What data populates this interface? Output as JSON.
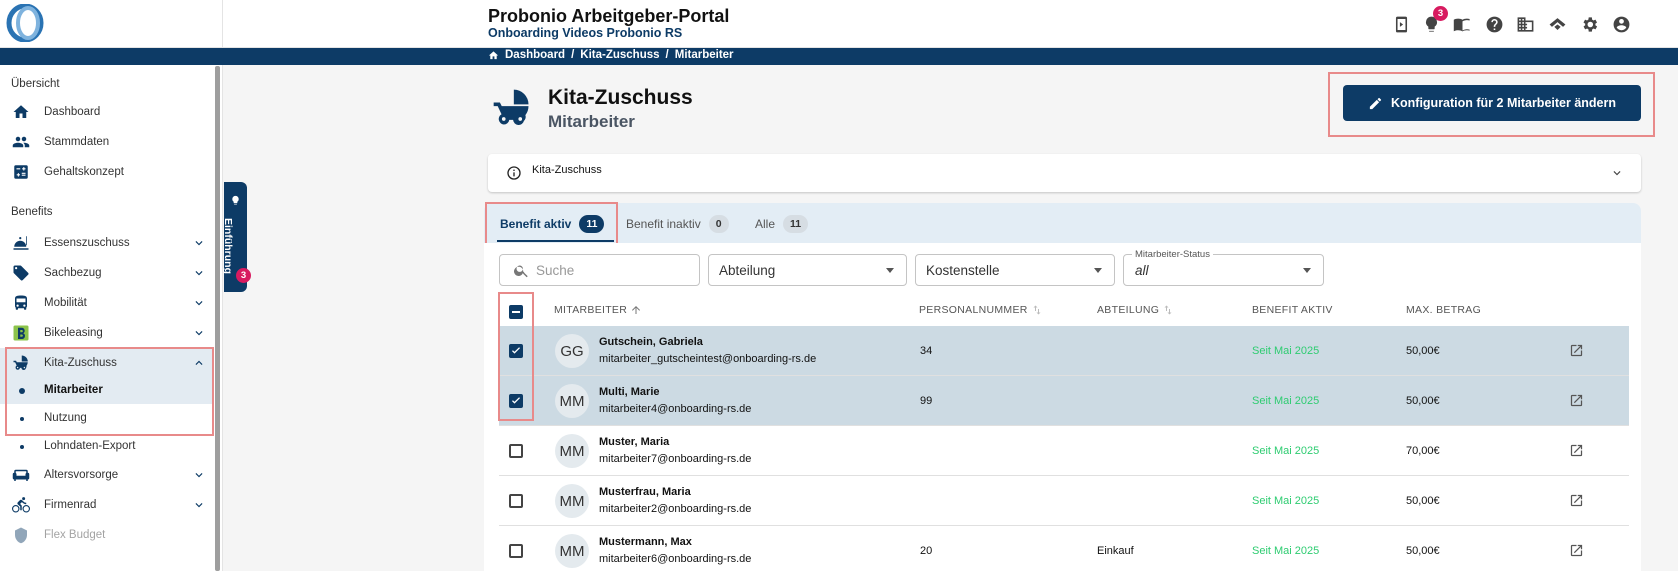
{
  "header": {
    "title": "Probonio Arbeitgeber-Portal",
    "subtitle": "Onboarding Videos Probonio RS",
    "notification_count": "3",
    "icons": [
      "phone-icon",
      "lightbulb-icon",
      "book-icon",
      "help-icon",
      "building-icon",
      "handshake-icon",
      "settings-icon",
      "account-icon"
    ]
  },
  "breadcrumb": {
    "items": [
      "Dashboard",
      "Kita-Zuschuss",
      "Mitarbeiter"
    ],
    "separator": "/"
  },
  "sidebar": {
    "section_overview": "Übersicht",
    "overview_items": [
      {
        "label": "Dashboard",
        "icon": "home-icon"
      },
      {
        "label": "Stammdaten",
        "icon": "people-icon"
      },
      {
        "label": "Gehaltskonzept",
        "icon": "calculator-icon"
      }
    ],
    "section_benefits": "Benefits",
    "benefit_items": [
      {
        "label": "Essenszuschuss",
        "icon": "food-icon"
      },
      {
        "label": "Sachbezug",
        "icon": "tag-icon"
      },
      {
        "label": "Mobilität",
        "icon": "bus-icon"
      },
      {
        "label": "Bikeleasing",
        "icon": "bikeleasing-icon"
      },
      {
        "label": "Kita-Zuschuss",
        "icon": "stroller-icon",
        "expanded": true
      }
    ],
    "kita_sub_items": [
      {
        "label": "Mitarbeiter",
        "active": true
      },
      {
        "label": "Nutzung"
      },
      {
        "label": "Lohndaten-Export"
      }
    ],
    "more_items": [
      {
        "label": "Altersvorsorge",
        "icon": "couch-icon"
      },
      {
        "label": "Firmenrad",
        "icon": "bike-icon"
      },
      {
        "label": "Flex Budget",
        "icon": "flex-icon"
      }
    ]
  },
  "tour": {
    "label": "Einführung",
    "count": "3"
  },
  "page": {
    "title": "Kita-Zuschuss",
    "subtitle": "Mitarbeiter",
    "config_button": "Konfiguration für 2 Mitarbeiter ändern",
    "info_text": "Kita-Zuschuss"
  },
  "tabs": [
    {
      "label": "Benefit aktiv",
      "count": "11",
      "active": true
    },
    {
      "label": "Benefit inaktiv",
      "count": "0"
    },
    {
      "label": "Alle",
      "count": "11"
    }
  ],
  "filters": {
    "search_placeholder": "Suche",
    "department": "Abteilung",
    "cost_center": "Kostenstelle",
    "status_label": "Mitarbeiter-Status",
    "status_value": "all"
  },
  "table": {
    "columns": [
      "MITARBEITER",
      "PERSONALNUMMER",
      "ABTEILUNG",
      "BENEFIT AKTIV",
      "MAX. BETRAG"
    ],
    "rows": [
      {
        "initials": "GG",
        "name": "Gutschein, Gabriela",
        "email": "mitarbeiter_gutscheintest@onboarding-rs.de",
        "personal_number": "34",
        "department": "",
        "benefit_active": "Seit Mai 2025",
        "max_amount": "50,00€",
        "selected": true
      },
      {
        "initials": "MM",
        "name": "Multi, Marie",
        "email": "mitarbeiter4@onboarding-rs.de",
        "personal_number": "99",
        "department": "",
        "benefit_active": "Seit Mai 2025",
        "max_amount": "50,00€",
        "selected": true
      },
      {
        "initials": "MM",
        "name": "Muster, Maria",
        "email": "mitarbeiter7@onboarding-rs.de",
        "personal_number": "",
        "department": "",
        "benefit_active": "Seit Mai 2025",
        "max_amount": "70,00€",
        "selected": false
      },
      {
        "initials": "MM",
        "name": "Musterfrau, Maria",
        "email": "mitarbeiter2@onboarding-rs.de",
        "personal_number": "",
        "department": "",
        "benefit_active": "Seit Mai 2025",
        "max_amount": "50,00€",
        "selected": false
      },
      {
        "initials": "MM",
        "name": "Mustermann, Max",
        "email": "mitarbeiter6@onboarding-rs.de",
        "personal_number": "20",
        "department": "Einkauf",
        "benefit_active": "Seit Mai 2025",
        "max_amount": "50,00€",
        "selected": false
      }
    ]
  },
  "colors": {
    "primary": "#0d3b66",
    "badge": "#d81b60",
    "selected_row": "#ccdae3",
    "benefit_active": "#2ecc71",
    "highlight": "#e88a8a"
  }
}
